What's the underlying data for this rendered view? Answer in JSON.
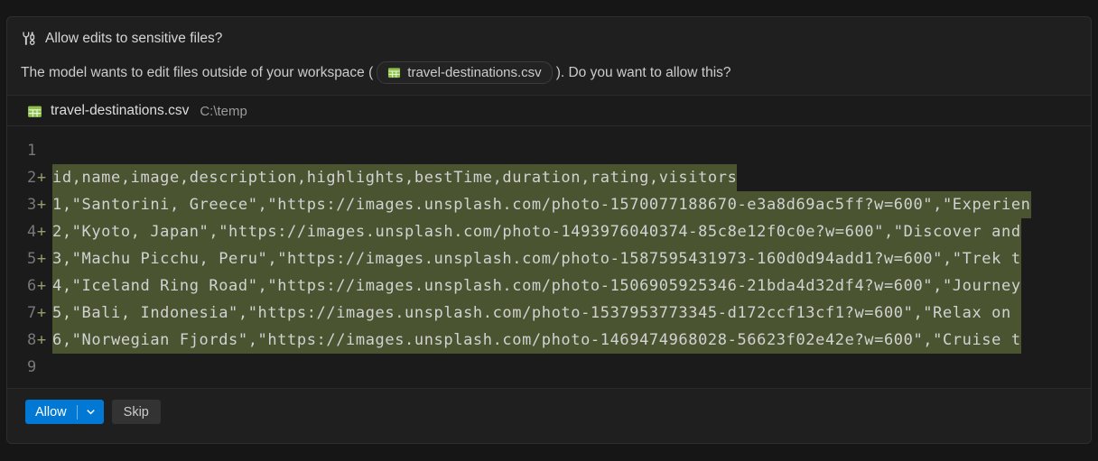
{
  "dialog": {
    "title": "Allow edits to sensitive files?",
    "message_prefix": "The model wants to edit files outside of your workspace (",
    "file_chip_label": "travel-destinations.csv",
    "message_suffix": "). Do you want to allow this?"
  },
  "code_block": {
    "file_name": "travel-destinations.csv",
    "file_path": "C:\\temp",
    "lines": [
      {
        "num": "1",
        "added": false,
        "text": ""
      },
      {
        "num": "2",
        "added": true,
        "text": "id,name,image,description,highlights,bestTime,duration,rating,visitors"
      },
      {
        "num": "3",
        "added": true,
        "text": "1,\"Santorini, Greece\",\"https://images.unsplash.com/photo-1570077188670-e3a8d69ac5ff?w=600\",\"Experien"
      },
      {
        "num": "4",
        "added": true,
        "text": "2,\"Kyoto, Japan\",\"https://images.unsplash.com/photo-1493976040374-85c8e12f0c0e?w=600\",\"Discover and"
      },
      {
        "num": "5",
        "added": true,
        "text": "3,\"Machu Picchu, Peru\",\"https://images.unsplash.com/photo-1587595431973-160d0d94add1?w=600\",\"Trek t"
      },
      {
        "num": "6",
        "added": true,
        "text": "4,\"Iceland Ring Road\",\"https://images.unsplash.com/photo-1506905925346-21bda4d32df4?w=600\",\"Journey"
      },
      {
        "num": "7",
        "added": true,
        "text": "5,\"Bali, Indonesia\",\"https://images.unsplash.com/photo-1537953773345-d172ccf13cf1?w=600\",\"Relax on "
      },
      {
        "num": "8",
        "added": true,
        "text": "6,\"Norwegian Fjords\",\"https://images.unsplash.com/photo-1469474968028-56623f02e42e?w=600\",\"Cruise t"
      },
      {
        "num": "9",
        "added": false,
        "text": ""
      }
    ]
  },
  "actions": {
    "allow_label": "Allow",
    "skip_label": "Skip"
  },
  "icons": {
    "header": "tools-icon",
    "file": "csv-table-icon",
    "dropdown": "chevron-down-icon"
  },
  "colors": {
    "accent_blue": "#0078d4",
    "csv_green": "#8dc149",
    "added_line_bg": "#4a5431"
  }
}
